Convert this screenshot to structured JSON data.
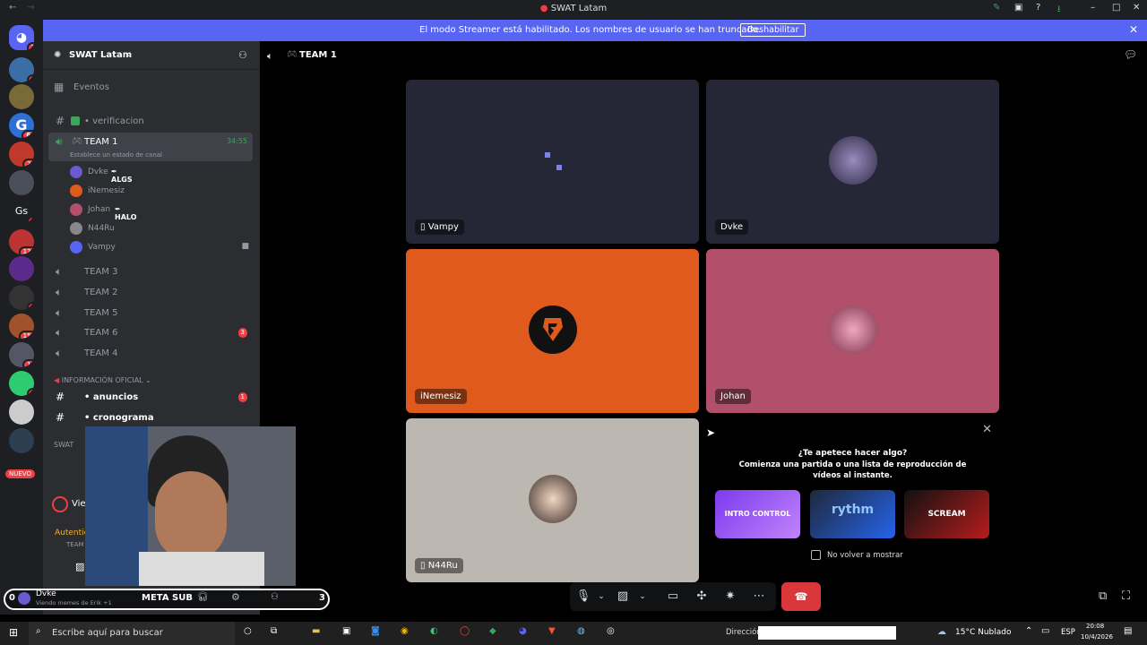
{
  "window": {
    "title": "SWAT Latam"
  },
  "banner": {
    "message": "El modo Streamer está habilitado. Los nombres de usuario se han truncado.",
    "button_label": "Deshabilitar"
  },
  "guilds": {
    "badges": [
      "1",
      "1",
      "66",
      "25",
      "1",
      "127",
      "2",
      "154",
      "19",
      "1"
    ],
    "gs_label": "Gs",
    "nuevo_label": "NUEVO"
  },
  "sidebar": {
    "server_name": "SWAT Latam",
    "events_label": "Eventos",
    "channels": {
      "verificacion": "• verificacion",
      "team1": "TEAM 1",
      "team1_timer": "34:55",
      "team1_status": "Establece un estado de canal",
      "team3": "TEAM 3",
      "team2": "TEAM 2",
      "team5": "TEAM 5",
      "team6": "TEAM 6",
      "team6_badge": "3",
      "team4": "TEAM 4",
      "category_info": "INFORMACIÓN OFICIAL",
      "anuncios": "• anuncios",
      "anuncios_badge": "1",
      "cronograma": "• cronograma",
      "swat_partial": "SWAT"
    },
    "voice_users": [
      {
        "name": "Dvke",
        "tag": "ALGS"
      },
      {
        "name": "iNemesiz",
        "tag": ""
      },
      {
        "name": "Johan",
        "tag": "HALO"
      },
      {
        "name": "N44Ru",
        "tag": ""
      },
      {
        "name": "Vampy",
        "tag": ""
      }
    ],
    "activity_label": "Viendo mem",
    "auth_label": "Autenticando",
    "auth_sub": "TEAM 1 / SWAT Lata",
    "user_name": "Dvke",
    "user_status": "Viendo memes de Erik +1"
  },
  "main": {
    "header_title": "TEAM 1",
    "tiles": [
      {
        "name": "Vampy",
        "bg": "#262736"
      },
      {
        "name": "Dvke",
        "bg": "#262736"
      },
      {
        "name": "iNemesiz",
        "bg": "#e05a1d"
      },
      {
        "name": "Johan",
        "bg": "#b2506c"
      },
      {
        "name": "N44Ru",
        "bg": "#bdb7b2"
      }
    ],
    "activity_panel": {
      "title": "¿Te apetece hacer algo?",
      "subtitle": "Comienza una partida o una lista de reproducción de vídeos al instante.",
      "games": [
        "INTRO CONTROL",
        "rythm",
        "SCREAM"
      ],
      "checkbox_label": "No volver a mostrar"
    }
  },
  "overlay": {
    "left_count": "0",
    "text": "META SUB",
    "right_count": "3"
  },
  "taskbar": {
    "search_placeholder": "Escribe aquí para buscar",
    "address_label": "Dirección",
    "weather": "15°C Nublado",
    "lang": "ESP",
    "time": "20:08",
    "date": "10/4/2026"
  },
  "colors": {
    "accent": "#5865f2",
    "danger": "#da373c",
    "sidebar": "#2b2d31"
  }
}
